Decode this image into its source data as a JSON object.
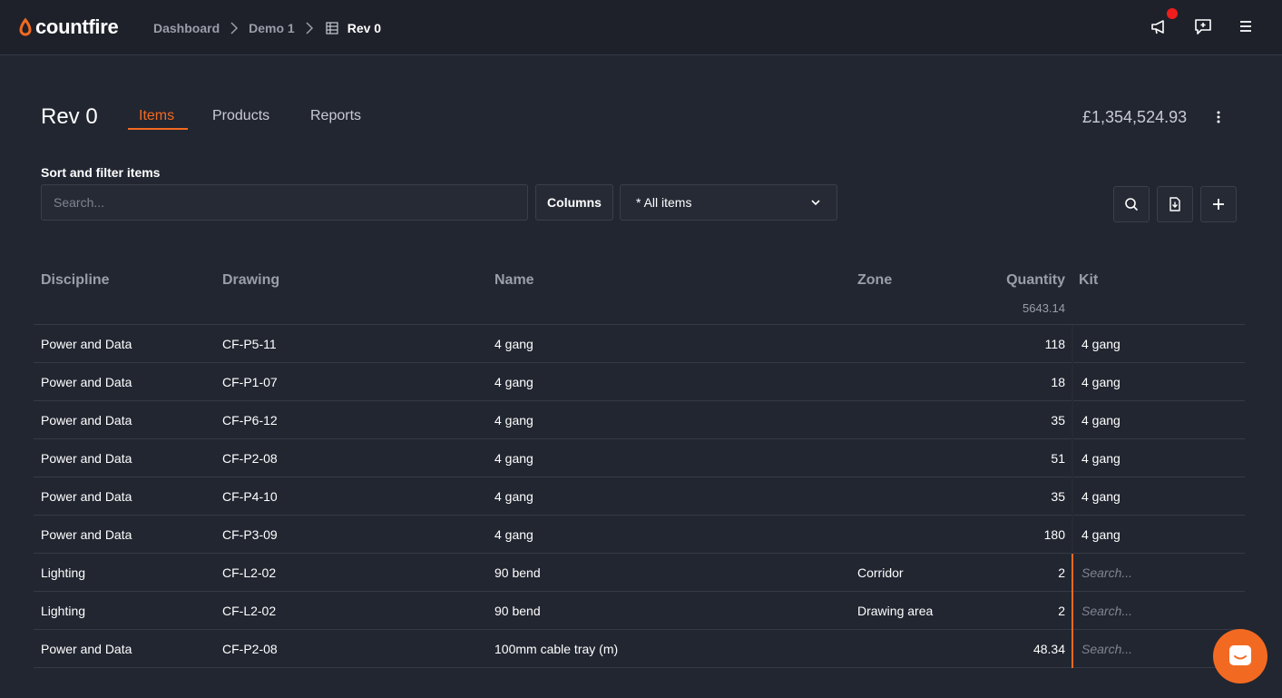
{
  "app": {
    "name": "countfire",
    "brand_color": "#f26a21",
    "background": "#222631"
  },
  "breadcrumb": [
    {
      "label": "Dashboard"
    },
    {
      "label": "Demo 1"
    },
    {
      "label": "Rev 0",
      "icon": "grid-icon"
    }
  ],
  "topbar_icons": [
    "megaphone-icon",
    "feedback-icon",
    "menu-icon"
  ],
  "page": {
    "title": "Rev 0",
    "tabs": [
      {
        "label": "Items",
        "active": true
      },
      {
        "label": "Products",
        "active": false
      },
      {
        "label": "Reports",
        "active": false
      }
    ],
    "total": "£1,354,524.93"
  },
  "filter": {
    "label": "Sort and filter items",
    "search_placeholder": "Search...",
    "columns_label": "Columns",
    "selected_view": "* All items"
  },
  "table": {
    "headers": {
      "discipline": "Discipline",
      "drawing": "Drawing",
      "name": "Name",
      "zone": "Zone",
      "quantity": "Quantity",
      "kit": "Kit"
    },
    "quantity_total": "5643.14",
    "kit_placeholder": "Search...",
    "rows": [
      {
        "discipline": "Power and Data",
        "drawing": "CF-P5-11",
        "name": "4 gang",
        "zone": "",
        "quantity": "118",
        "kit": "4 gang"
      },
      {
        "discipline": "Power and Data",
        "drawing": "CF-P1-07",
        "name": "4 gang",
        "zone": "",
        "quantity": "18",
        "kit": "4 gang"
      },
      {
        "discipline": "Power and Data",
        "drawing": "CF-P6-12",
        "name": "4 gang",
        "zone": "",
        "quantity": "35",
        "kit": "4 gang"
      },
      {
        "discipline": "Power and Data",
        "drawing": "CF-P2-08",
        "name": "4 gang",
        "zone": "",
        "quantity": "51",
        "kit": "4 gang"
      },
      {
        "discipline": "Power and Data",
        "drawing": "CF-P4-10",
        "name": "4 gang",
        "zone": "",
        "quantity": "35",
        "kit": "4 gang"
      },
      {
        "discipline": "Power and Data",
        "drawing": "CF-P3-09",
        "name": "4 gang",
        "zone": "",
        "quantity": "180",
        "kit": "4 gang"
      },
      {
        "discipline": "Lighting",
        "drawing": "CF-L2-02",
        "name": "90 bend",
        "zone": "Corridor",
        "quantity": "2",
        "kit": ""
      },
      {
        "discipline": "Lighting",
        "drawing": "CF-L2-02",
        "name": "90 bend",
        "zone": "Drawing area",
        "quantity": "2",
        "kit": ""
      },
      {
        "discipline": "Power and Data",
        "drawing": "CF-P2-08",
        "name": "100mm cable tray (m)",
        "zone": "",
        "quantity": "48.34",
        "kit": ""
      }
    ]
  }
}
